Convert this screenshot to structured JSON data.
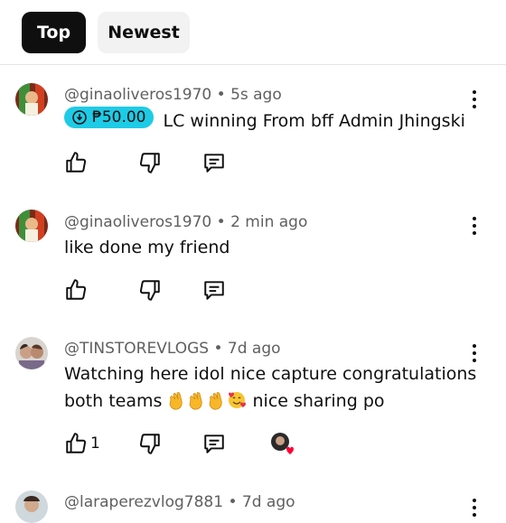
{
  "tabs": {
    "top_label": "Top",
    "newest_label": "Newest"
  },
  "comments": [
    {
      "author": "@ginaoliveros1970",
      "time": "5s ago",
      "super_thanks": "₱50.00",
      "text": "LC winning From bff Admin Jhingski",
      "likes": ""
    },
    {
      "author": "@ginaoliveros1970",
      "time": "2 min ago",
      "text": "like done my friend",
      "likes": ""
    },
    {
      "author": "@TINSTOREVLOGS",
      "time": "7d ago",
      "text_before_emoji": "Watching here idol nice capture congratulations both teams",
      "text_after_emoji": "nice sharing po",
      "emojis": [
        "clapping-hands",
        "clapping-hands",
        "clapping-hands",
        "smiling-face-with-hearts"
      ],
      "likes": "1",
      "creator_heart": true
    },
    {
      "author": "@laraperezvlog7881",
      "time": "7d ago"
    }
  ],
  "separator": "•",
  "colors": {
    "accent_super_thanks": "#1ecbe6",
    "heart": "#ff0033"
  }
}
